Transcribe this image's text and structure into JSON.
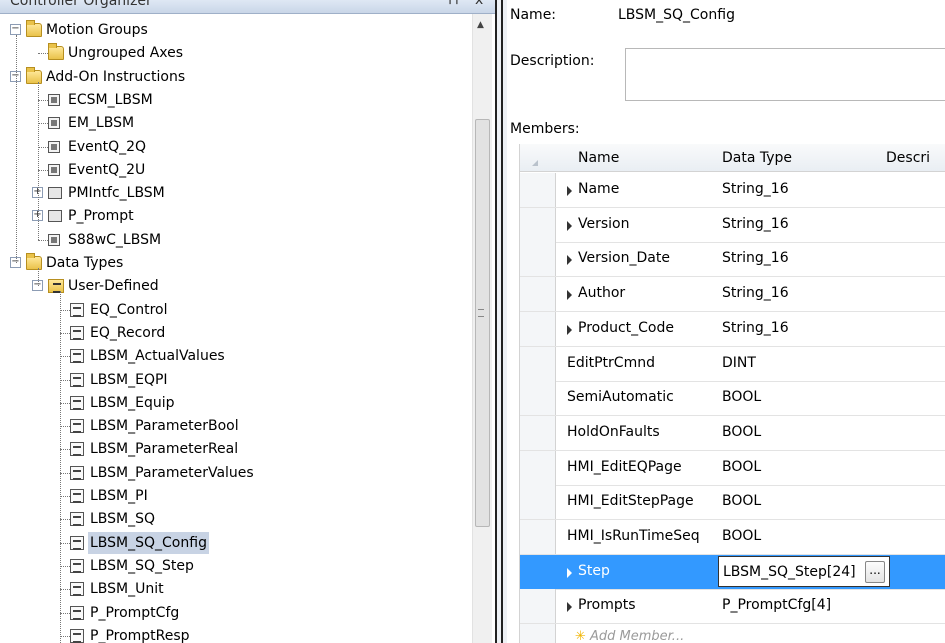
{
  "organizer": {
    "title": "Controller Organizer",
    "pin_icon": "pin-icon",
    "close_icon": "close-icon"
  },
  "tree": {
    "items": [
      {
        "label": "Motion Groups",
        "icon": "folder-icon",
        "level": 0,
        "expander": "minus"
      },
      {
        "label": "Ungrouped Axes",
        "icon": "folder-icon",
        "level": 1,
        "expander": ""
      },
      {
        "label": "Add-On Instructions",
        "icon": "folder-icon",
        "level": 0,
        "expander": "minus"
      },
      {
        "label": "ECSM_LBSM",
        "icon": "aoi-icon",
        "level": 1,
        "expander": ""
      },
      {
        "label": "EM_LBSM",
        "icon": "aoi-icon",
        "level": 1,
        "expander": ""
      },
      {
        "label": "EventQ_2Q",
        "icon": "aoi-icon",
        "level": 1,
        "expander": ""
      },
      {
        "label": "EventQ_2U",
        "icon": "aoi-icon",
        "level": 1,
        "expander": ""
      },
      {
        "label": "PMIntfc_LBSM",
        "icon": "aoi-folder-icon",
        "level": 1,
        "expander": "plus"
      },
      {
        "label": "P_Prompt",
        "icon": "aoi-folder-icon",
        "level": 1,
        "expander": "plus"
      },
      {
        "label": "S88wC_LBSM",
        "icon": "aoi-icon",
        "level": 1,
        "expander": ""
      },
      {
        "label": "Data Types",
        "icon": "folder-icon",
        "level": 0,
        "expander": "minus"
      },
      {
        "label": "User-Defined",
        "icon": "user-defined-folder-icon",
        "level": 1,
        "expander": "minus"
      },
      {
        "label": "EQ_Control",
        "icon": "udt-icon",
        "level": 2,
        "expander": ""
      },
      {
        "label": "EQ_Record",
        "icon": "udt-icon",
        "level": 2,
        "expander": ""
      },
      {
        "label": "LBSM_ActualValues",
        "icon": "udt-icon",
        "level": 2,
        "expander": ""
      },
      {
        "label": "LBSM_EQPI",
        "icon": "udt-icon",
        "level": 2,
        "expander": ""
      },
      {
        "label": "LBSM_Equip",
        "icon": "udt-icon",
        "level": 2,
        "expander": ""
      },
      {
        "label": "LBSM_ParameterBool",
        "icon": "udt-icon",
        "level": 2,
        "expander": ""
      },
      {
        "label": "LBSM_ParameterReal",
        "icon": "udt-icon",
        "level": 2,
        "expander": ""
      },
      {
        "label": "LBSM_ParameterValues",
        "icon": "udt-icon",
        "level": 2,
        "expander": ""
      },
      {
        "label": "LBSM_PI",
        "icon": "udt-icon",
        "level": 2,
        "expander": ""
      },
      {
        "label": "LBSM_SQ",
        "icon": "udt-icon",
        "level": 2,
        "expander": ""
      },
      {
        "label": "LBSM_SQ_Config",
        "icon": "udt-icon",
        "level": 2,
        "expander": "",
        "selected": true
      },
      {
        "label": "LBSM_SQ_Step",
        "icon": "udt-icon",
        "level": 2,
        "expander": ""
      },
      {
        "label": "LBSM_Unit",
        "icon": "udt-icon",
        "level": 2,
        "expander": ""
      },
      {
        "label": "P_PromptCfg",
        "icon": "udt-icon",
        "level": 2,
        "expander": ""
      },
      {
        "label": "P_PromptResp",
        "icon": "udt-icon",
        "level": 2,
        "expander": ""
      }
    ]
  },
  "editor": {
    "name_label": "Name:",
    "name_value": "LBSM_SQ_Config",
    "description_label": "Description:",
    "description_value": "",
    "members_label": "Members:",
    "columns": [
      "Name",
      "Data Type",
      "Descri"
    ],
    "members": [
      {
        "name": "Name",
        "type": "String_16",
        "expandable": true
      },
      {
        "name": "Version",
        "type": "String_16",
        "expandable": true
      },
      {
        "name": "Version_Date",
        "type": "String_16",
        "expandable": true
      },
      {
        "name": "Author",
        "type": "String_16",
        "expandable": true
      },
      {
        "name": "Product_Code",
        "type": "String_16",
        "expandable": true
      },
      {
        "name": "EditPtrCmnd",
        "type": "DINT",
        "expandable": false
      },
      {
        "name": "SemiAutomatic",
        "type": "BOOL",
        "expandable": false
      },
      {
        "name": "HoldOnFaults",
        "type": "BOOL",
        "expandable": false
      },
      {
        "name": "HMI_EditEQPage",
        "type": "BOOL",
        "expandable": false
      },
      {
        "name": "HMI_EditStepPage",
        "type": "BOOL",
        "expandable": false
      },
      {
        "name": "HMI_IsRunTimeSeq",
        "type": "BOOL",
        "expandable": false
      },
      {
        "name": "Step",
        "type": "LBSM_SQ_Step[24]",
        "expandable": true,
        "selected": true,
        "editing": true
      },
      {
        "name": "Prompts",
        "type": "P_PromptCfg[4]",
        "expandable": true
      }
    ],
    "add_member_label": "Add Member...",
    "ellipsis_label": "..."
  }
}
